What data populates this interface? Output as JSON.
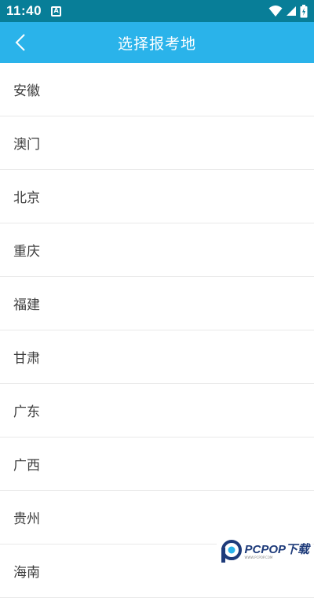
{
  "status_bar": {
    "time": "11:40",
    "notification_icon": "A",
    "icons": [
      "wifi-icon",
      "signal-icon",
      "battery-icon"
    ]
  },
  "app_bar": {
    "title": "选择报考地",
    "back_icon": "chevron-left-icon"
  },
  "colors": {
    "status_bar": "#087e98",
    "app_bar": "#2ab3ea",
    "list_text": "#3c3c3c",
    "divider": "#e9e9e9"
  },
  "regions": [
    "安徽",
    "澳门",
    "北京",
    "重庆",
    "福建",
    "甘肃",
    "广东",
    "广西",
    "贵州",
    "海南"
  ],
  "watermark": {
    "main": "PCPOP下载",
    "sub": "WWW.PCPOP.COM"
  }
}
